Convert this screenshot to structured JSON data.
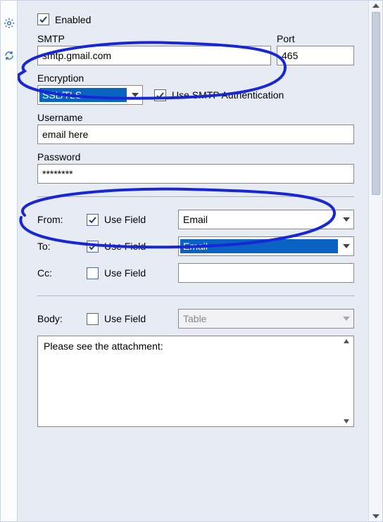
{
  "enabled": {
    "label": "Enabled",
    "checked": true
  },
  "smtp": {
    "label": "SMTP",
    "value": "smtp.gmail.com"
  },
  "port": {
    "label": "Port",
    "value": "465"
  },
  "encryption": {
    "label": "Encryption",
    "value": "SSL/TLS"
  },
  "auth": {
    "label": "Use SMTP Authentication",
    "checked": true
  },
  "username": {
    "label": "Username",
    "value": "email here"
  },
  "password": {
    "label": "Password",
    "value": "********"
  },
  "from": {
    "label": "From:",
    "useFieldLabel": "Use Field",
    "useFieldChecked": true,
    "fieldValue": "Email"
  },
  "to": {
    "label": "To:",
    "useFieldLabel": "Use Field",
    "useFieldChecked": true,
    "fieldValue": "Email"
  },
  "cc": {
    "label": "Cc:",
    "useFieldLabel": "Use Field",
    "useFieldChecked": false,
    "fieldValue": ""
  },
  "body": {
    "label": "Body:",
    "useFieldLabel": "Use Field",
    "useFieldChecked": false,
    "fieldValue": "Table",
    "text": "Please see the attachment:"
  },
  "colors": {
    "accent": "#0a63c2",
    "bg": "#e7ecf4"
  }
}
